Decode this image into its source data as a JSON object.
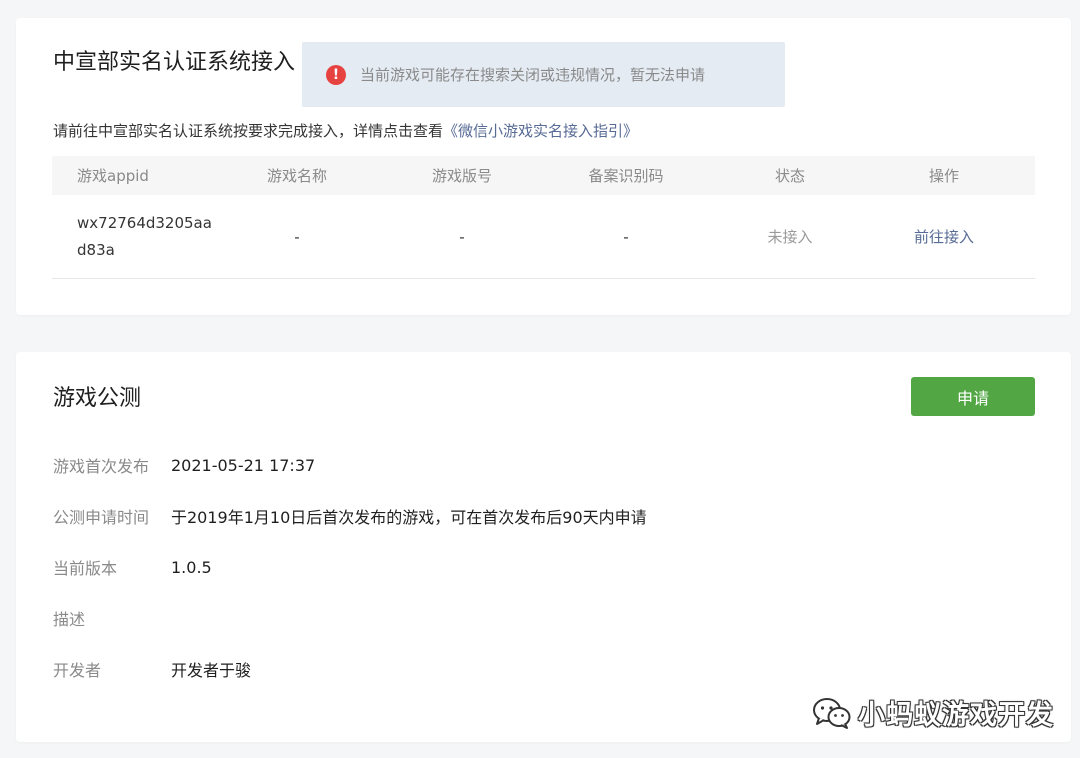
{
  "realname": {
    "title": "中宣部实名认证系统接入",
    "intro_text": "请前往中宣部实名认证系统按要求完成接入，详情点击查看",
    "intro_link": "《微信小游戏实名接入指引》",
    "columns": [
      "游戏appid",
      "游戏名称",
      "游戏版号",
      "备案识别码",
      "状态",
      "操作"
    ],
    "rows": [
      {
        "appid": "wx72764d3205aad83a",
        "name": "-",
        "license": "-",
        "record_code": "-",
        "status": "未接入",
        "action": "前往接入"
      }
    ]
  },
  "toast": {
    "icon": "error-circle-icon",
    "icon_glyph": "!",
    "message": "当前游戏可能存在搜索关闭或违规情况，暂无法申请"
  },
  "public_test": {
    "title": "游戏公测",
    "apply_label": "申请",
    "info": [
      {
        "label": "游戏首次发布",
        "value": "2021-05-21 17:37"
      },
      {
        "label": "公测申请时间",
        "value": "于2019年1月10日后首次发布的游戏，可在首次发布后90天内申请"
      },
      {
        "label": "当前版本",
        "value": "1.0.5"
      },
      {
        "label": "描述",
        "value": ""
      },
      {
        "label": "开发者",
        "value": "开发者于骏"
      }
    ]
  },
  "watermark": {
    "icon": "wechat-icon",
    "text": "小蚂蚁游戏开发"
  },
  "colors": {
    "accent_green": "#52a744",
    "link_blue": "#576b95",
    "error_red": "#e64340",
    "toast_bg": "#e4ebf3"
  }
}
